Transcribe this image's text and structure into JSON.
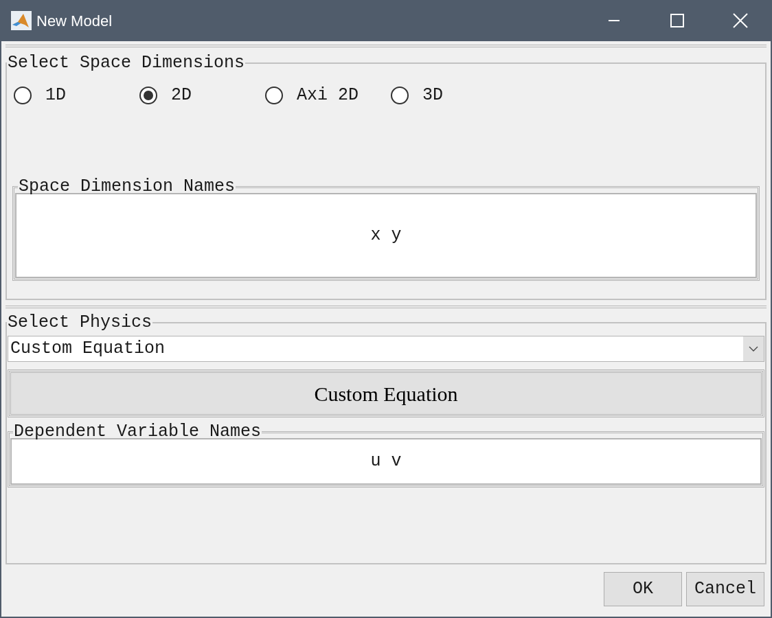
{
  "window": {
    "title": "New Model"
  },
  "space_dimensions": {
    "title": "Select Space Dimensions",
    "options": [
      {
        "label": "1D",
        "selected": false
      },
      {
        "label": "2D",
        "selected": true
      },
      {
        "label": "Axi 2D",
        "selected": false
      },
      {
        "label": "3D",
        "selected": false
      }
    ]
  },
  "space_dimension_names": {
    "title": "Space Dimension Names",
    "value": "x y"
  },
  "physics": {
    "title": "Select Physics",
    "dropdown": {
      "value": "Custom Equation"
    },
    "button": "Custom Equation"
  },
  "dependent_variable_names": {
    "title": "Dependent Variable Names",
    "value": "u v"
  },
  "buttons": [
    "OK",
    "Cancel"
  ]
}
